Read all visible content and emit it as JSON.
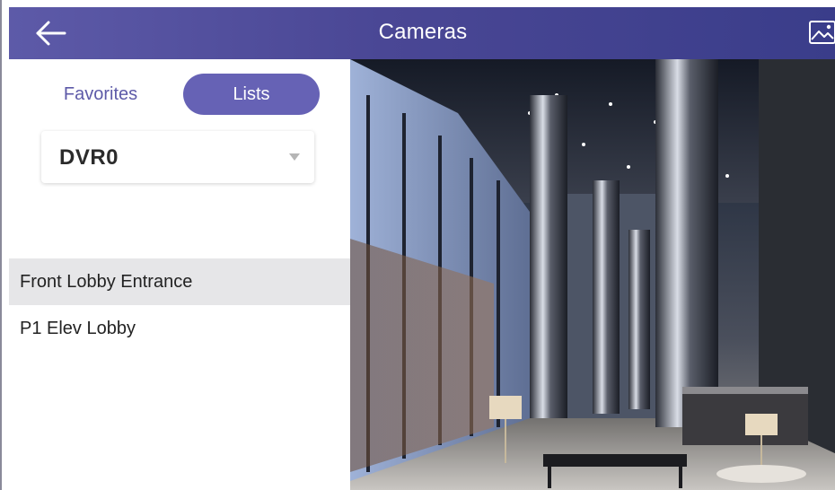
{
  "header": {
    "title": "Cameras",
    "back_icon": "arrow-left-icon",
    "right_icon": "image-icon",
    "color_start": "#5d5aa8",
    "color_end": "#3a3d8a"
  },
  "tabs": [
    {
      "label": "Favorites",
      "active": false
    },
    {
      "label": "Lists",
      "active": true
    }
  ],
  "dvr_select": {
    "value": "DVR0",
    "icon": "chevron-down-icon"
  },
  "cameras": [
    {
      "label": "Front Lobby Entrance",
      "selected": true
    },
    {
      "label": "P1 Elev Lobby",
      "selected": false
    }
  ],
  "camera_view": {
    "scene": "lobby-interior",
    "accent": "#c9d4ec"
  }
}
